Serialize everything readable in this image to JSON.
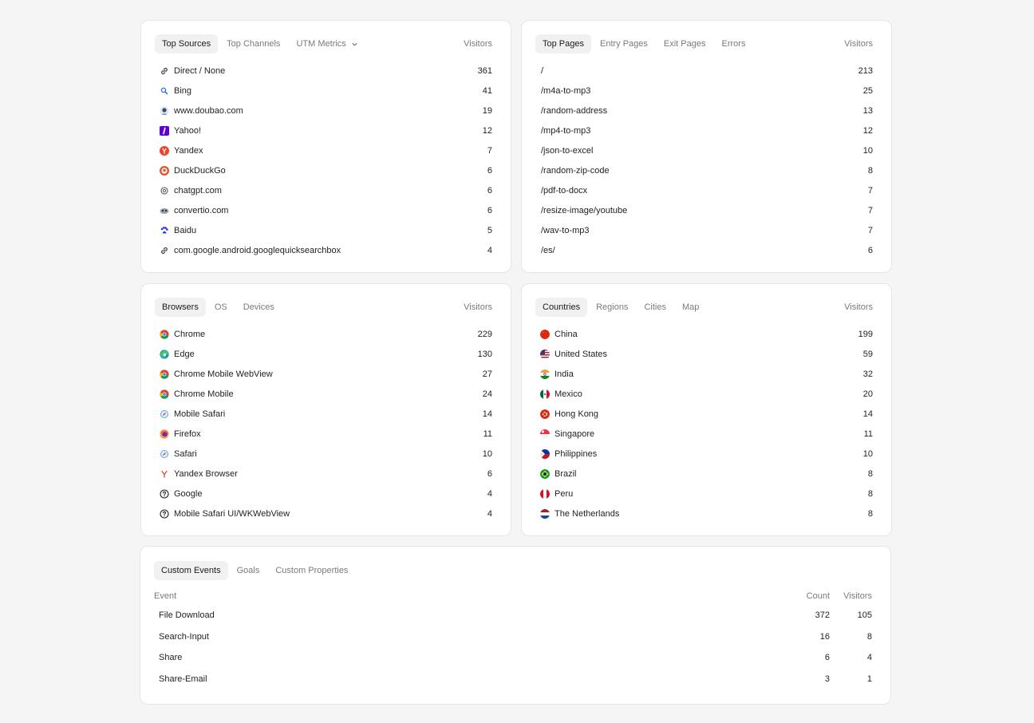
{
  "sources": {
    "tabs": [
      "Top Sources",
      "Top Channels",
      "UTM Metrics"
    ],
    "visitors_label": "Visitors",
    "rows": [
      {
        "label": "Direct / None",
        "value": "361",
        "icon": "link-icon"
      },
      {
        "label": "Bing",
        "value": "41",
        "icon": "bing-icon"
      },
      {
        "label": "www.doubao.com",
        "value": "19",
        "icon": "doubao-icon"
      },
      {
        "label": "Yahoo!",
        "value": "12",
        "icon": "yahoo-icon"
      },
      {
        "label": "Yandex",
        "value": "7",
        "icon": "yandex-icon"
      },
      {
        "label": "DuckDuckGo",
        "value": "6",
        "icon": "duckduckgo-icon"
      },
      {
        "label": "chatgpt.com",
        "value": "6",
        "icon": "chatgpt-icon"
      },
      {
        "label": "convertio.com",
        "value": "6",
        "icon": "convertio-icon"
      },
      {
        "label": "Baidu",
        "value": "5",
        "icon": "baidu-icon"
      },
      {
        "label": "com.google.android.googlequicksearchbox",
        "value": "4",
        "icon": "link-icon"
      }
    ]
  },
  "pages": {
    "tabs": [
      "Top Pages",
      "Entry Pages",
      "Exit Pages",
      "Errors"
    ],
    "visitors_label": "Visitors",
    "rows": [
      {
        "label": "/",
        "value": "213"
      },
      {
        "label": "/m4a-to-mp3",
        "value": "25"
      },
      {
        "label": "/random-address",
        "value": "13"
      },
      {
        "label": "/mp4-to-mp3",
        "value": "12"
      },
      {
        "label": "/json-to-excel",
        "value": "10"
      },
      {
        "label": "/random-zip-code",
        "value": "8"
      },
      {
        "label": "/pdf-to-docx",
        "value": "7"
      },
      {
        "label": "/resize-image/youtube",
        "value": "7"
      },
      {
        "label": "/wav-to-mp3",
        "value": "7"
      },
      {
        "label": "/es/",
        "value": "6"
      }
    ]
  },
  "browsers": {
    "tabs": [
      "Browsers",
      "OS",
      "Devices"
    ],
    "visitors_label": "Visitors",
    "rows": [
      {
        "label": "Chrome",
        "value": "229",
        "icon": "chrome-icon"
      },
      {
        "label": "Edge",
        "value": "130",
        "icon": "edge-icon"
      },
      {
        "label": "Chrome Mobile WebView",
        "value": "27",
        "icon": "chrome-icon"
      },
      {
        "label": "Chrome Mobile",
        "value": "24",
        "icon": "chrome-icon"
      },
      {
        "label": "Mobile Safari",
        "value": "14",
        "icon": "safari-icon"
      },
      {
        "label": "Firefox",
        "value": "11",
        "icon": "firefox-icon"
      },
      {
        "label": "Safari",
        "value": "10",
        "icon": "safari-icon"
      },
      {
        "label": "Yandex Browser",
        "value": "6",
        "icon": "yandex-browser-icon"
      },
      {
        "label": "Google",
        "value": "4",
        "icon": "question-icon"
      },
      {
        "label": "Mobile Safari UI/WKWebView",
        "value": "4",
        "icon": "question-icon"
      }
    ]
  },
  "countries": {
    "tabs": [
      "Countries",
      "Regions",
      "Cities",
      "Map"
    ],
    "visitors_label": "Visitors",
    "rows": [
      {
        "label": "China",
        "value": "199",
        "icon": "flag-china-icon"
      },
      {
        "label": "United States",
        "value": "59",
        "icon": "flag-us-icon"
      },
      {
        "label": "India",
        "value": "32",
        "icon": "flag-india-icon"
      },
      {
        "label": "Mexico",
        "value": "20",
        "icon": "flag-mexico-icon"
      },
      {
        "label": "Hong Kong",
        "value": "14",
        "icon": "flag-hongkong-icon"
      },
      {
        "label": "Singapore",
        "value": "11",
        "icon": "flag-singapore-icon"
      },
      {
        "label": "Philippines",
        "value": "10",
        "icon": "flag-philippines-icon"
      },
      {
        "label": "Brazil",
        "value": "8",
        "icon": "flag-brazil-icon"
      },
      {
        "label": "Peru",
        "value": "8",
        "icon": "flag-peru-icon"
      },
      {
        "label": "The Netherlands",
        "value": "8",
        "icon": "flag-netherlands-icon"
      }
    ]
  },
  "events": {
    "tabs": [
      "Custom Events",
      "Goals",
      "Custom Properties"
    ],
    "columns": {
      "event": "Event",
      "count": "Count",
      "visitors": "Visitors"
    },
    "rows": [
      {
        "name": "File Download",
        "count": "372",
        "visitors": "105"
      },
      {
        "name": "Search-Input",
        "count": "16",
        "visitors": "8"
      },
      {
        "name": "Share",
        "count": "6",
        "visitors": "4"
      },
      {
        "name": "Share-Email",
        "count": "3",
        "visitors": "1"
      }
    ]
  }
}
